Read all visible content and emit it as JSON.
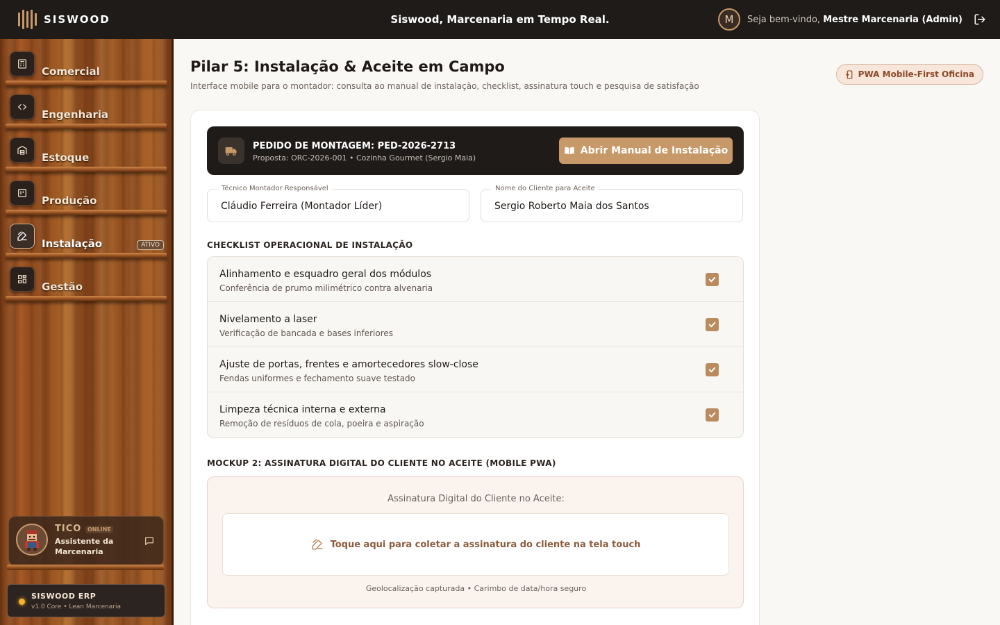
{
  "header": {
    "brand": "SISWOOD",
    "title": "Siswood, Marcenaria em Tempo Real.",
    "avatar_initial": "M",
    "welcome_prefix": "Seja bem-vindo,",
    "user_name": "Mestre Marcenaria (Admin)"
  },
  "sidebar": {
    "items": [
      {
        "label": "Comercial",
        "icon": "calculator-icon"
      },
      {
        "label": "Engenharia",
        "icon": "code-icon"
      },
      {
        "label": "Estoque",
        "icon": "warehouse-icon"
      },
      {
        "label": "Produção",
        "icon": "kanban-icon"
      },
      {
        "label": "Instalação",
        "icon": "signature-icon",
        "badge": "ATIVO"
      },
      {
        "label": "Gestão",
        "icon": "dashboard-icon"
      }
    ],
    "assistant": {
      "name": "TICO",
      "status": "ONLINE",
      "role": "Assistente da Marcenaria"
    },
    "erp": {
      "title": "SISWOOD ERP",
      "version": "v1.0 Core • Lean Marcenaria"
    }
  },
  "page": {
    "title": "Pilar 5: Instalação & Aceite em Campo",
    "subtitle": "Interface mobile para o montador: consulta ao manual de instalação, checklist, assinatura touch e pesquisa de satisfação",
    "badge": "PWA Mobile-First Oficina"
  },
  "order": {
    "title": "PEDIDO DE MONTAGEM: PED-2026-2713",
    "subtitle": "Proposta: ORC-2026-001 • Cozinha Gourmet (Sergio Maia)",
    "manual_button": "Abrir Manual de Instalação"
  },
  "fields": {
    "technician_label": "Técnico Montador Responsável",
    "technician_value": "Cláudio Ferreira (Montador Líder)",
    "client_label": "Nome do Cliente para Aceite",
    "client_value": "Sergio Roberto Maia dos Santos"
  },
  "checklist": {
    "title": "CHECKLIST OPERACIONAL DE INSTALAÇÃO",
    "items": [
      {
        "title": "Alinhamento e esquadro geral dos módulos",
        "subtitle": "Conferência de prumo milimétrico contra alvenaria",
        "checked": true
      },
      {
        "title": "Nivelamento a laser",
        "subtitle": "Verificação de bancada e bases inferiores",
        "checked": true
      },
      {
        "title": "Ajuste de portas, frentes e amortecedores slow-close",
        "subtitle": "Fendas uniformes e fechamento suave testado",
        "checked": true
      },
      {
        "title": "Limpeza técnica interna e externa",
        "subtitle": "Remoção de resíduos de cola, poeira e aspiração",
        "checked": true
      }
    ]
  },
  "signature": {
    "section_title": "MOCKUP 2: ASSINATURA DIGITAL DO CLIENTE NO ACEITE (MOBILE PWA)",
    "label": "Assinatura Digital do Cliente no Aceite:",
    "cta": "Toque aqui para coletar a assinatura do cliente na tela touch",
    "footer": "Geolocalização capturada • Carimbo de data/hora seguro"
  },
  "colors": {
    "accent": "#c89968",
    "dark": "#1f1b19",
    "checkbox": "#b98b5e"
  }
}
